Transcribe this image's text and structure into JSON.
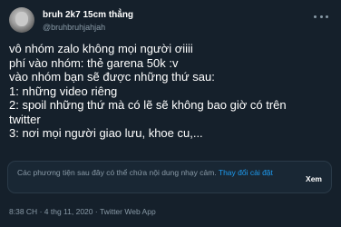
{
  "author": {
    "display_name": "bruh 2k7 15cm thẳng",
    "handle": "@bruhbruhjahjah"
  },
  "icons": {
    "avatar": "profile-avatar",
    "more": "more-options-icon"
  },
  "tweet": {
    "lines": [
      "vô nhóm zalo không mọi người ơiiii",
      "phí vào nhóm: thẻ garena 50k :v",
      "vào nhóm bạn sẽ được những thứ sau:",
      "1: những video riêng",
      "2: spoil những thứ mà có lẽ sẽ không bao giờ có trên",
      "twitter",
      "3: nơi mọi người giao lưu, khoe cu,..."
    ]
  },
  "sensitive_notice": {
    "text": "Các phương tiện sau đây có thể chứa nội dung nhạy cảm.",
    "change_settings": "Thay đổi cài đặt",
    "view_label": "Xem"
  },
  "meta": {
    "time": "8:38 CH",
    "date": "4 thg 11, 2020",
    "source": "Twitter Web App",
    "separator": "·"
  },
  "colors": {
    "background": "#15202b",
    "secondary_text": "#8899a6",
    "link": "#1d9bf0"
  }
}
